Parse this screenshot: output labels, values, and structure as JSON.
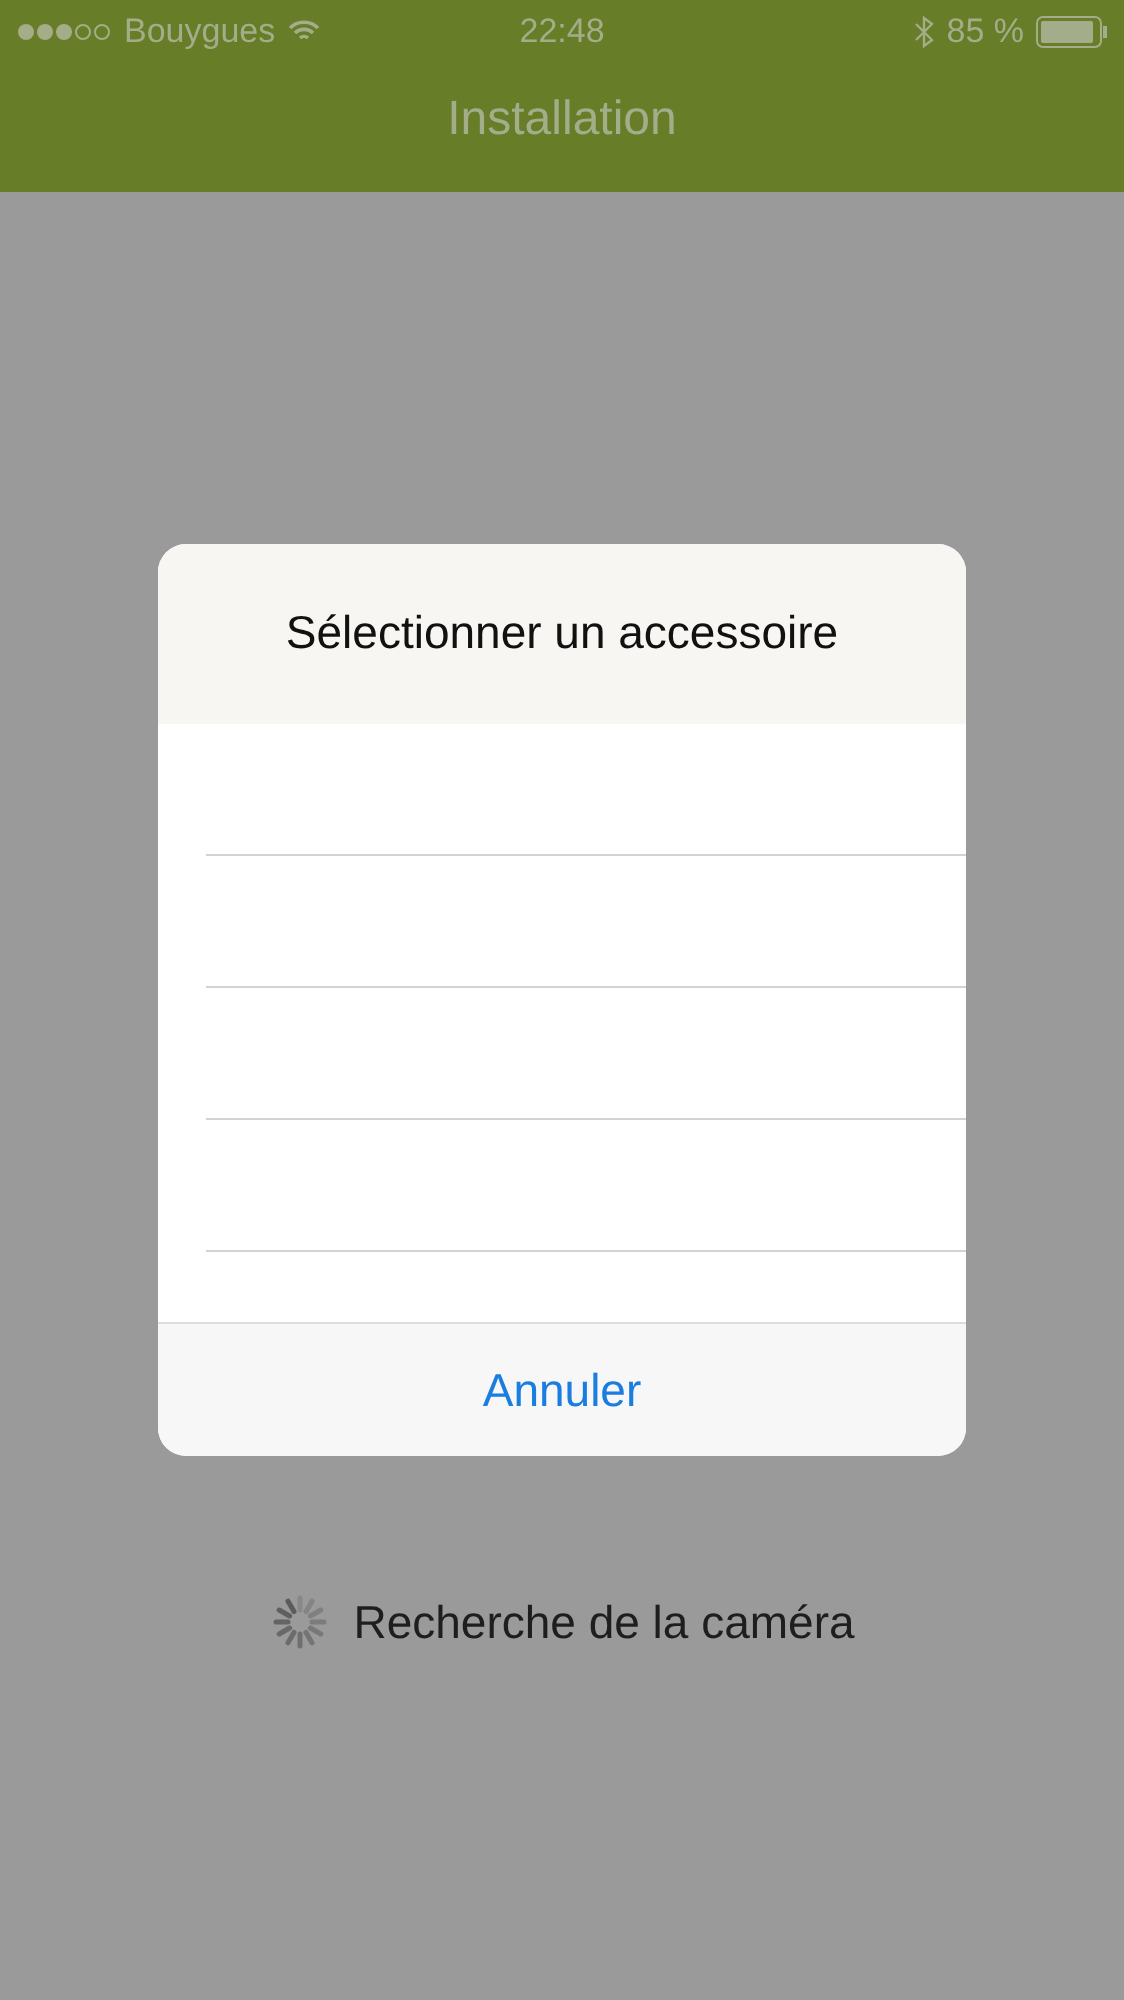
{
  "status_bar": {
    "carrier": "Bouygues",
    "time": "22:48",
    "battery": "85 %"
  },
  "nav_bar": {
    "title": "Installation"
  },
  "dialog": {
    "title": "Sélectionner un accessoire",
    "cancel": "Annuler"
  },
  "status": {
    "text": "Recherche de la caméra"
  }
}
